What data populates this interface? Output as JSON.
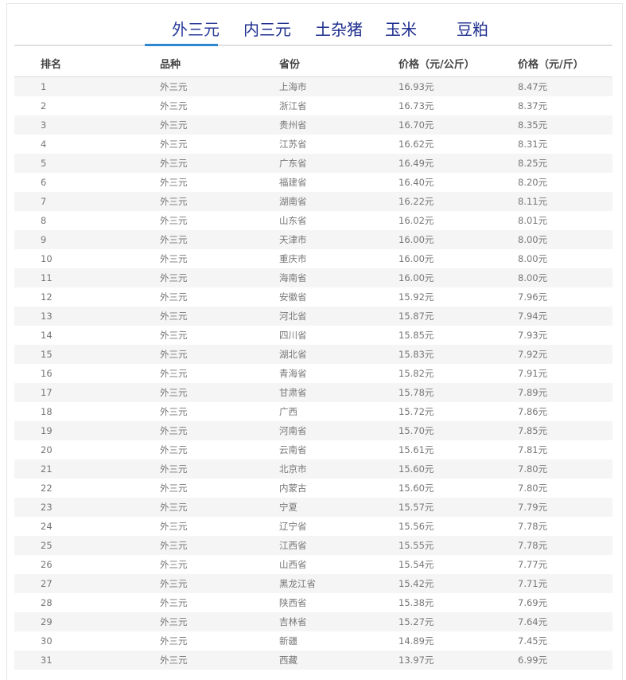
{
  "tabs": [
    {
      "label": "外三元",
      "active": true
    },
    {
      "label": "内三元",
      "active": false
    },
    {
      "label": "土杂猪",
      "active": false
    },
    {
      "label": "玉米",
      "active": false
    },
    {
      "label": "豆粕",
      "active": false
    }
  ],
  "accent_color": "#2f87d0",
  "tab_color": "#1f2f8f",
  "table": {
    "headers": [
      "排名",
      "品种",
      "省份",
      "价格（元/公斤）",
      "价格（元/斤）"
    ],
    "rows": [
      [
        "1",
        "外三元",
        "上海市",
        "16.93元",
        "8.47元"
      ],
      [
        "2",
        "外三元",
        "浙江省",
        "16.73元",
        "8.37元"
      ],
      [
        "3",
        "外三元",
        "贵州省",
        "16.70元",
        "8.35元"
      ],
      [
        "4",
        "外三元",
        "江苏省",
        "16.62元",
        "8.31元"
      ],
      [
        "5",
        "外三元",
        "广东省",
        "16.49元",
        "8.25元"
      ],
      [
        "6",
        "外三元",
        "福建省",
        "16.40元",
        "8.20元"
      ],
      [
        "7",
        "外三元",
        "湖南省",
        "16.22元",
        "8.11元"
      ],
      [
        "8",
        "外三元",
        "山东省",
        "16.02元",
        "8.01元"
      ],
      [
        "9",
        "外三元",
        "天津市",
        "16.00元",
        "8.00元"
      ],
      [
        "10",
        "外三元",
        "重庆市",
        "16.00元",
        "8.00元"
      ],
      [
        "11",
        "外三元",
        "海南省",
        "16.00元",
        "8.00元"
      ],
      [
        "12",
        "外三元",
        "安徽省",
        "15.92元",
        "7.96元"
      ],
      [
        "13",
        "外三元",
        "河北省",
        "15.87元",
        "7.94元"
      ],
      [
        "14",
        "外三元",
        "四川省",
        "15.85元",
        "7.93元"
      ],
      [
        "15",
        "外三元",
        "湖北省",
        "15.83元",
        "7.92元"
      ],
      [
        "16",
        "外三元",
        "青海省",
        "15.82元",
        "7.91元"
      ],
      [
        "17",
        "外三元",
        "甘肃省",
        "15.78元",
        "7.89元"
      ],
      [
        "18",
        "外三元",
        "广西",
        "15.72元",
        "7.86元"
      ],
      [
        "19",
        "外三元",
        "河南省",
        "15.70元",
        "7.85元"
      ],
      [
        "20",
        "外三元",
        "云南省",
        "15.61元",
        "7.81元"
      ],
      [
        "21",
        "外三元",
        "北京市",
        "15.60元",
        "7.80元"
      ],
      [
        "22",
        "外三元",
        "内蒙古",
        "15.60元",
        "7.80元"
      ],
      [
        "23",
        "外三元",
        "宁夏",
        "15.57元",
        "7.79元"
      ],
      [
        "24",
        "外三元",
        "辽宁省",
        "15.56元",
        "7.78元"
      ],
      [
        "25",
        "外三元",
        "江西省",
        "15.55元",
        "7.78元"
      ],
      [
        "26",
        "外三元",
        "山西省",
        "15.54元",
        "7.77元"
      ],
      [
        "27",
        "外三元",
        "黑龙江省",
        "15.42元",
        "7.71元"
      ],
      [
        "28",
        "外三元",
        "陕西省",
        "15.38元",
        "7.69元"
      ],
      [
        "29",
        "外三元",
        "吉林省",
        "15.27元",
        "7.64元"
      ],
      [
        "30",
        "外三元",
        "新疆",
        "14.89元",
        "7.45元"
      ],
      [
        "31",
        "外三元",
        "西藏",
        "13.97元",
        "6.99元"
      ]
    ]
  }
}
